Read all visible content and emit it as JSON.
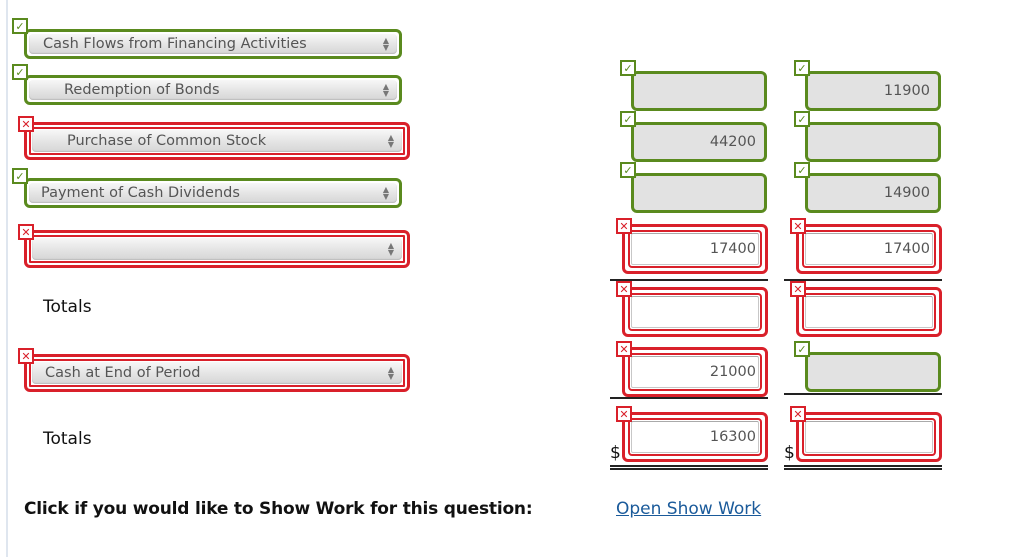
{
  "rows": [
    {
      "select": "Cash Flows from Financing Activities",
      "select_status": "correct"
    },
    {
      "select": "Redemption of Bonds",
      "select_status": "correct",
      "col1": "",
      "col1_status": "correct",
      "col2": "11900",
      "col2_status": "correct"
    },
    {
      "select": "Purchase of Common Stock",
      "select_status": "incorrect",
      "col1": "44200",
      "col1_status": "correct",
      "col2": "",
      "col2_status": "correct"
    },
    {
      "select": "Payment of Cash Dividends",
      "select_status": "correct",
      "col1": "",
      "col1_status": "correct",
      "col2": "14900",
      "col2_status": "correct"
    },
    {
      "select": "",
      "select_status": "incorrect",
      "col1": "17400",
      "col1_status": "incorrect",
      "col2": "17400",
      "col2_status": "incorrect"
    }
  ],
  "totals1": {
    "label": "Totals",
    "col1": "",
    "col1_status": "incorrect",
    "col2": "",
    "col2_status": "incorrect"
  },
  "cash_end": {
    "select": "Cash at End of Period",
    "select_status": "incorrect",
    "col1": "21000",
    "col1_status": "incorrect",
    "col2": "",
    "col2_status": "correct"
  },
  "totals2": {
    "label": "Totals",
    "currency": "$",
    "col1": "16300",
    "col1_status": "incorrect",
    "col2": "",
    "col2_status": "incorrect"
  },
  "icons": {
    "correct": "✓",
    "incorrect": "✕",
    "select_arrows": "▲▼"
  },
  "colors": {
    "correct": "#5a8a1e",
    "incorrect": "#d9202a",
    "link": "#1a5a9a"
  },
  "footer": {
    "prompt": "Click if you would like to Show Work for this question:",
    "link": "Open Show Work"
  }
}
